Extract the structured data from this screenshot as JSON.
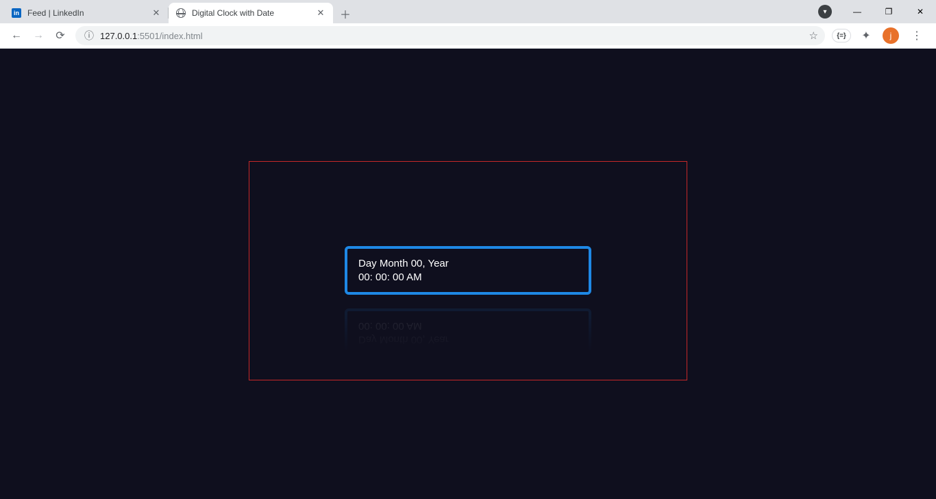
{
  "browser": {
    "tabs": [
      {
        "title": "Feed | LinkedIn",
        "active": false,
        "favicon": "linkedin",
        "favlabel": "in"
      },
      {
        "title": "Digital Clock with Date",
        "active": true,
        "favicon": "globe"
      }
    ],
    "window_controls": {
      "minimize": "—",
      "maximize": "❐",
      "close": "✕"
    },
    "url": {
      "host": "127.0.0.1",
      "port_path": ":5501/index.html"
    },
    "profile_initial": "j",
    "ext_badge": "{=}"
  },
  "page": {
    "date_line": "Day Month 00, Year",
    "time_line": "00: 00: 00 AM"
  }
}
